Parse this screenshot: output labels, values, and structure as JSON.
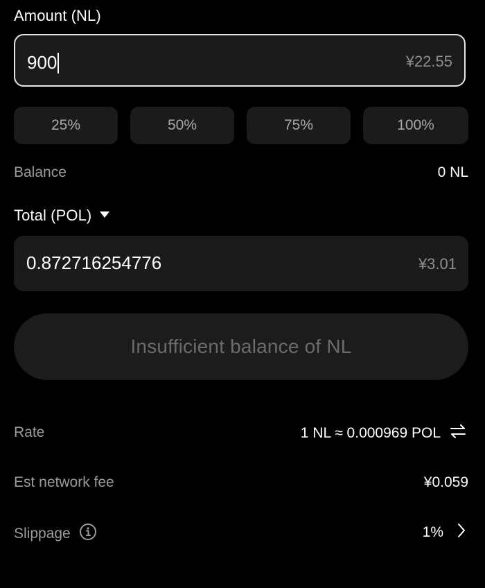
{
  "amount": {
    "label": "Amount (NL)",
    "value": "900",
    "fiat": "¥22.55"
  },
  "percent_buttons": [
    "25%",
    "50%",
    "75%",
    "100%"
  ],
  "balance": {
    "label": "Balance",
    "value": "0 NL"
  },
  "total": {
    "label": "Total (POL)",
    "value": "0.872716254776",
    "fiat": "¥3.01"
  },
  "submit": {
    "label": "Insufficient balance of NL"
  },
  "details": {
    "rate_label": "Rate",
    "rate_value": "1 NL ≈ 0.000969 POL",
    "fee_label": "Est network fee",
    "fee_value": "¥0.059",
    "slippage_label": "Slippage",
    "slippage_value": "1%"
  },
  "icons": {
    "dropdown": "caret-down-icon",
    "swap": "swap-arrows-icon",
    "info": "info-icon",
    "chevron": "chevron-right-icon"
  }
}
